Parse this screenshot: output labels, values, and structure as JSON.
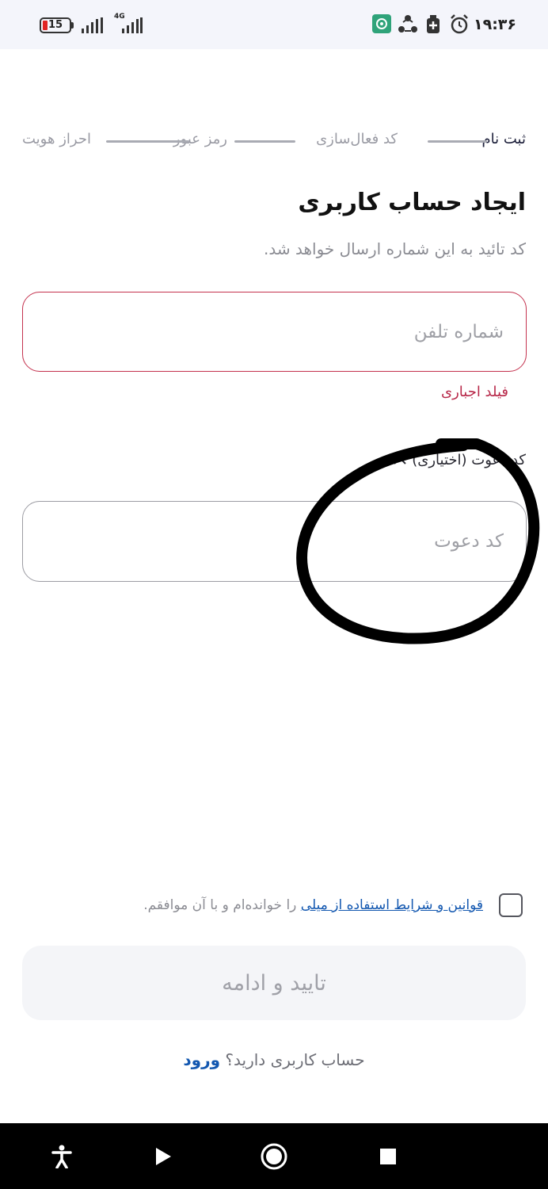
{
  "status_bar": {
    "battery": "15",
    "network": "4G",
    "time": "۱۹:۳۶"
  },
  "stepper": {
    "steps": [
      "ثبت نام",
      "کد فعال‌سازی",
      "رمز عبور",
      "احراز هویت"
    ]
  },
  "form": {
    "title": "ایجاد حساب کاربری",
    "subtitle": "کد تائید به این شماره ارسال خواهد شد.",
    "phone_placeholder": "شماره تلفن",
    "phone_error": "فیلد اجباری",
    "invite_toggle_label": "کد دعوت (اختیاری)",
    "invite_placeholder": "کد دعوت"
  },
  "terms": {
    "link_text": "قوانین و شرایط استفاده از میلی",
    "suffix_text": " را خوانده‌ام و با آن موافقم."
  },
  "confirm_button": "تایید و ادامه",
  "login": {
    "prompt": "حساب کاربری دارید؟ ",
    "link": "ورود"
  }
}
